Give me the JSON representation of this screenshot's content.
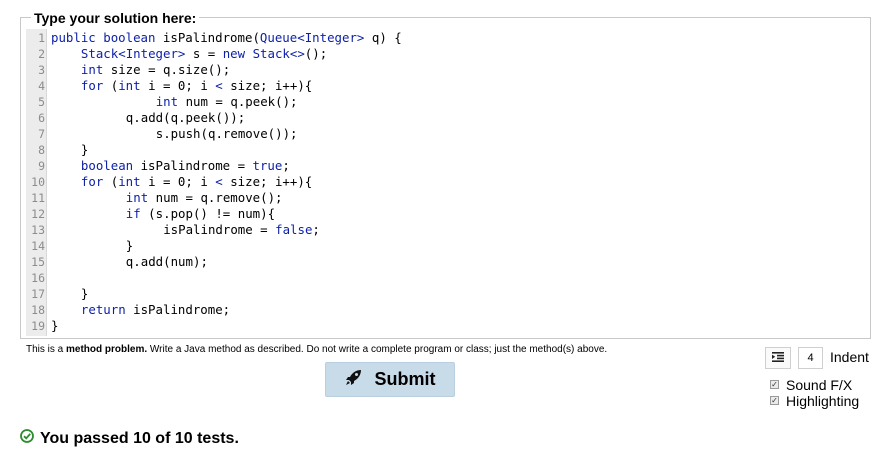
{
  "legend": "Type your solution here:",
  "code_lines": [
    {
      "n": "1",
      "indent": 0,
      "t": "public boolean isPalindrome(Queue<Integer> q) {"
    },
    {
      "n": "2",
      "indent": 4,
      "t": "Stack<Integer> s = new Stack<>();"
    },
    {
      "n": "3",
      "indent": 4,
      "t": "int size = q.size();"
    },
    {
      "n": "4",
      "indent": 4,
      "t": "for (int i = 0; i < size; i++){"
    },
    {
      "n": "5",
      "indent": 14,
      "t": "int num = q.peek();"
    },
    {
      "n": "6",
      "indent": 10,
      "t": "q.add(q.peek());"
    },
    {
      "n": "7",
      "indent": 14,
      "t": "s.push(q.remove());"
    },
    {
      "n": "8",
      "indent": 4,
      "t": "}"
    },
    {
      "n": "9",
      "indent": 4,
      "t": "boolean isPalindrome = true;"
    },
    {
      "n": "10",
      "indent": 4,
      "t": "for (int i = 0; i < size; i++){"
    },
    {
      "n": "11",
      "indent": 10,
      "t": "int num = q.remove();"
    },
    {
      "n": "12",
      "indent": 10,
      "t": "if (s.pop() != num){"
    },
    {
      "n": "13",
      "indent": 15,
      "t": "isPalindrome = false;"
    },
    {
      "n": "14",
      "indent": 10,
      "t": "}"
    },
    {
      "n": "15",
      "indent": 10,
      "t": "q.add(num);"
    },
    {
      "n": "16",
      "indent": 0,
      "t": ""
    },
    {
      "n": "17",
      "indent": 4,
      "t": "}"
    },
    {
      "n": "18",
      "indent": 4,
      "t": "return isPalindrome;"
    },
    {
      "n": "19",
      "indent": 0,
      "t": "}"
    }
  ],
  "hint": {
    "prefix": "This is a ",
    "bold": "method problem.",
    "rest": " Write a Java method as described. Do not write a complete program or class; just the method(s) above."
  },
  "submit": {
    "label": "Submit",
    "icon": "rocket-icon"
  },
  "indent": {
    "icon": "indent-icon",
    "value": "4",
    "label": "Indent"
  },
  "options": [
    {
      "label": "Sound F/X",
      "checked": true
    },
    {
      "label": "Highlighting",
      "checked": true
    }
  ],
  "result": {
    "icon": "check-circle-icon",
    "text": "You passed 10 of 10 tests.",
    "color": "#2e8b2e"
  },
  "colors": {
    "keyword": "#0b1fa8",
    "submit_bg": "#c8dbe9"
  }
}
